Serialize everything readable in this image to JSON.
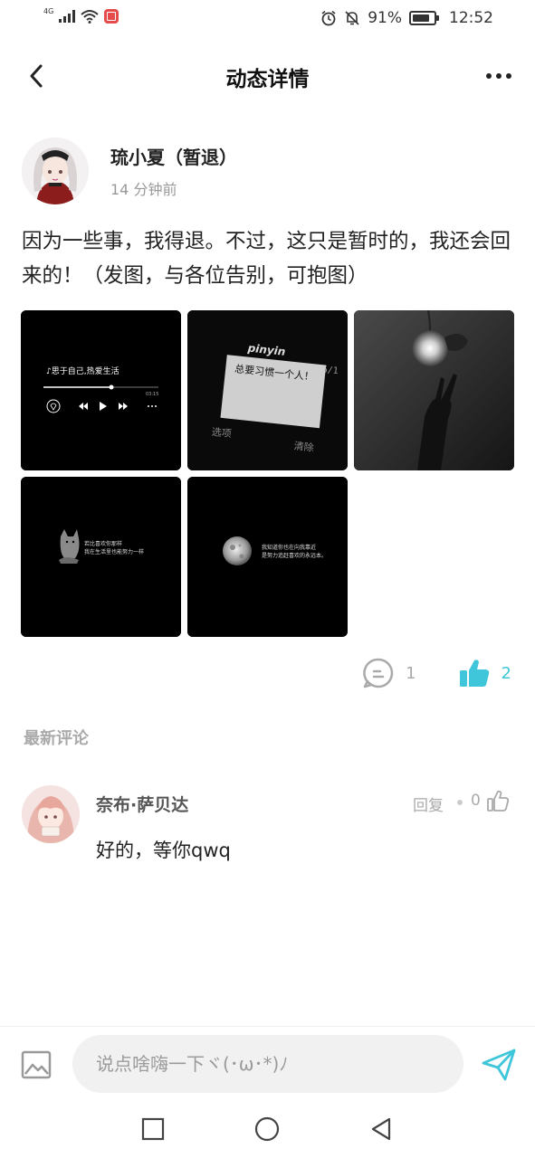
{
  "status_bar": {
    "network": "4G",
    "battery_percent": "91%",
    "time": "12:52"
  },
  "header": {
    "title": "动态详情"
  },
  "post": {
    "author": "琉小夏（暂退）",
    "time": "14 分钟前",
    "text": "因为一些事，我得退。不过，这只是暂时的，我还会回来的！（发图，与各位告别，可抱图）",
    "images": [
      {
        "caption_line1": "♪思于自己,热爱生活",
        "duration": "03:15"
      },
      {
        "brand": "pinyin",
        "counter": "896/1",
        "screen_text": "总要习惯一个人！",
        "left_key": "选项",
        "right_key": "清除"
      },
      {
        "description": "lamp-and-hand"
      },
      {
        "line1": "若比喜欢你那样",
        "line2": "我在生活里也能努力一样"
      },
      {
        "line1": "我知道你也在向我靠近",
        "line2": "是努力追赶喜欢的永远本。"
      }
    ],
    "comment_count": "1",
    "like_count": "2"
  },
  "comments_section": {
    "title": "最新评论"
  },
  "comments": [
    {
      "author": "奈布·萨贝达",
      "reply_label": "回复",
      "like_count": "0",
      "text": "好的，等你qwq"
    }
  ],
  "input_bar": {
    "placeholder": "说点啥嗨一下ヾ(･ω･*)ﾉ"
  },
  "colors": {
    "accent": "#3fc6da",
    "muted": "#aaaaaa",
    "text": "#222222"
  }
}
